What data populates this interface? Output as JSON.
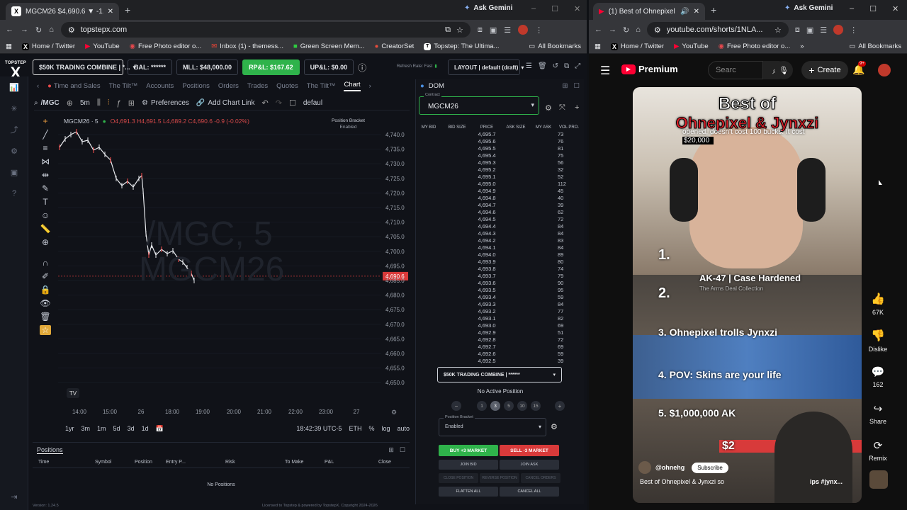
{
  "left_window": {
    "tab_title": "MGCM26 $4,690.6 ▼ -1.06%",
    "ask_gemini": "Ask Gemini",
    "url": "topstepx.com",
    "bookmarks": [
      "Home / Twitter",
      "YouTube",
      "Free Photo editor o...",
      "Inbox (1) - themess...",
      "Green Screen Mem...",
      "CreatorSet",
      "Topstep: The Ultima..."
    ],
    "all_bookmarks": "All Bookmarks"
  },
  "topstep": {
    "logo_top": "TOPSTEP",
    "logo_x": "X",
    "account": "$50K TRADING COMBINE | *...",
    "bal": "BAL: ******",
    "mll": "MLL: $48,000.00",
    "rpnl": "RP&L: $167.62",
    "upnl": "UP&L: $0.00",
    "refresh_rate": "Refresh Rate: Fast",
    "layout": "LAYOUT | default (draft)",
    "tabs": [
      "Time and Sales",
      "The Tilt™",
      "Accounts",
      "Positions",
      "Orders",
      "Trades",
      "Quotes",
      "The Tilt™",
      "Chart"
    ],
    "symbol": "/MGC",
    "timeframe": "5m",
    "preferences": "Preferences",
    "add_chart_link": "Add Chart Link",
    "default_label": "defaul",
    "chart_symbol": "MGCM26 · 5",
    "ohlc": "O4,691.3  H4,691.5  L4,689.2  C4,690.6  -0.9 (-0.02%)",
    "position_bracket": "Position Bracket",
    "enabled": "Enabled",
    "watermark_1": "/MGC, 5",
    "watermark_2": "MGCM26",
    "price_labels": [
      "4,740.0",
      "4,735.0",
      "4,730.0",
      "4,725.0",
      "4,720.0",
      "4,715.0",
      "4,710.0",
      "4,705.0",
      "4,700.0",
      "4,695.0",
      "4,690.6",
      "4,685.0",
      "4,680.0",
      "4,675.0",
      "4,670.0",
      "4,665.0",
      "4,660.0",
      "4,655.0",
      "4,650.0"
    ],
    "time_labels": [
      "14:00",
      "15:00",
      "26",
      "18:00",
      "19:00",
      "20:00",
      "21:00",
      "22:00",
      "23:00",
      "27"
    ],
    "ranges": [
      "1yr",
      "3m",
      "1m",
      "5d",
      "3d",
      "1d"
    ],
    "clock": "18:42:39 UTC-5",
    "session": "ETH",
    "pct": "%",
    "log": "log",
    "auto": "auto",
    "positions_title": "Positions",
    "positions_cols": [
      "Time",
      "Symbol",
      "Position",
      "Entry P...",
      "Risk",
      "To Make",
      "P&L",
      "Close"
    ],
    "no_positions": "No Positions",
    "version": "Version: 1.24.5",
    "license": "Licensed to Topstep & powered by TopstepX. Copyright 2024-2026"
  },
  "dom": {
    "title": "DOM",
    "contract_label": "Contract",
    "contract": "MGCM26",
    "cols": [
      "MY BID",
      "BID SIZE",
      "PRICE",
      "ASK SIZE",
      "MY ASK",
      "VOL PRO."
    ],
    "prices": [
      "4,695.7",
      "4,695.6",
      "4,695.5",
      "4,695.4",
      "4,695.3",
      "4,695.2",
      "4,695.1",
      "4,695.0",
      "4,694.9",
      "4,694.8",
      "4,694.7",
      "4,694.6",
      "4,694.5",
      "4,694.4",
      "4,694.3",
      "4,694.2",
      "4,694.1",
      "4,694.0",
      "4,693.9",
      "4,693.8",
      "4,693.7",
      "4,693.6",
      "4,693.5",
      "4,693.4",
      "4,693.3",
      "4,693.2",
      "4,693.1",
      "4,693.0",
      "4,692.9",
      "4,692.8",
      "4,692.7",
      "4,692.6",
      "4,692.5"
    ],
    "volumes": [
      "73",
      "76",
      "81",
      "75",
      "56",
      "32",
      "52",
      "112",
      "45",
      "40",
      "39",
      "62",
      "72",
      "84",
      "84",
      "83",
      "84",
      "89",
      "80",
      "74",
      "79",
      "90",
      "95",
      "59",
      "84",
      "77",
      "82",
      "69",
      "51",
      "72",
      "69",
      "59",
      "39"
    ],
    "account": "$50K TRADING COMBINE | ******",
    "no_active": "No Active Position",
    "qty": [
      "1",
      "3",
      "5",
      "10",
      "15"
    ],
    "bracket_label": "Position Bracket",
    "bracket_value": "Enabled",
    "buy": "BUY +3 MARKET",
    "sell": "SELL -3 MARKET",
    "join_bid": "JOIN BID",
    "join_ask": "JOIN ASK",
    "close_pos": "CLOSE POSITION",
    "reverse_pos": "REVERSE POSITION",
    "cancel_orders": "CANCEL ORDERS",
    "flatten": "FLATTEN ALL",
    "cancel_all": "CANCEL ALL"
  },
  "right_window": {
    "tab_title": "(1) Best of Ohnepixel & Jyn",
    "ask_gemini": "Ask Gemini",
    "url": "youtube.com/shorts/1NLA...",
    "bookmarks": [
      "Home / Twitter",
      "YouTube",
      "Free Photo editor o..."
    ],
    "all_bookmarks": "All Bookmarks"
  },
  "youtube": {
    "brand": "Premium",
    "search_placeholder": "Searc",
    "create": "Create",
    "notif_count": "9+",
    "title_1": "Best of",
    "title_2": "Ohnepixel & Jynxzi",
    "caption": "opened, doesn't cost 100 bucks. It cost",
    "caption_2": "$20,000",
    "rank1": "1.",
    "rank2": "2.",
    "ak_title": "AK-47 | Case Hardened",
    "ak_sub": "The Arms Deal Collection",
    "rank3": "3. Ohnepixel trolls Jynxzi",
    "rank4": "4. POV: Skins are your life",
    "rank5": "5. $1,000,000 AK",
    "price_tag": "$2",
    "channel": "@ohnehg",
    "subscribe": "Subscribe",
    "video_title": "Best of Ohnepixel & Jynxzi so",
    "tags": "ips #jynx...",
    "likes": "67K",
    "dislike": "Dislike",
    "comments": "162",
    "share": "Share",
    "remix": "Remix"
  },
  "colors": {
    "accent_green": "#2fb34b",
    "accent_red": "#d83a3a",
    "yt_red": "#ff0033",
    "price_tag": "#d83a3a"
  }
}
